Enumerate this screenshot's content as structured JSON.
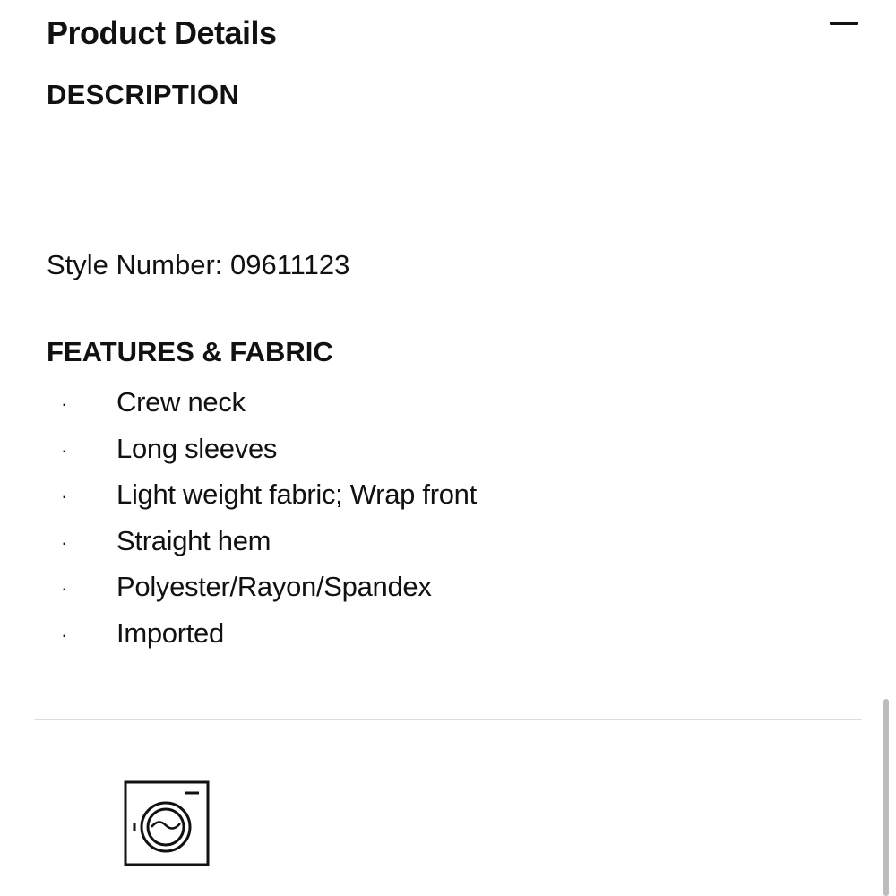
{
  "header": {
    "title": "Product Details",
    "toggle_icon": "minus-icon"
  },
  "description": {
    "heading": "DESCRIPTION",
    "style_number": "Style Number: 09611123"
  },
  "features": {
    "heading": "FEATURES & FABRIC",
    "bullet": "·",
    "items": [
      "Crew neck",
      "Long sleeves",
      "Light weight fabric; Wrap front",
      "Straight hem",
      "Polyester/Rayon/Spandex",
      "Imported"
    ]
  },
  "care": {
    "icon": "machine-wash-icon"
  }
}
